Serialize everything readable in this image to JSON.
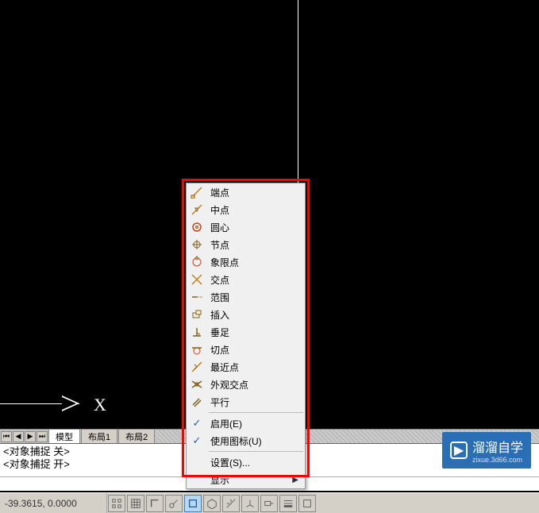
{
  "canvas": {
    "coord_display": "-39.3615, 0.0000"
  },
  "tabs": {
    "items": [
      "模型",
      "布局1",
      "布局2"
    ],
    "active_index": 0
  },
  "command_log": {
    "lines": [
      "<对象捕捉 关>",
      "<对象捕捉 开>"
    ]
  },
  "osnap_menu": {
    "items": [
      {
        "label": "端点",
        "icon": "endpoint"
      },
      {
        "label": "中点",
        "icon": "midpoint"
      },
      {
        "label": "圆心",
        "icon": "center"
      },
      {
        "label": "节点",
        "icon": "node"
      },
      {
        "label": "象限点",
        "icon": "quadrant"
      },
      {
        "label": "交点",
        "icon": "intersection"
      },
      {
        "label": "范围",
        "icon": "extension"
      },
      {
        "label": "插入",
        "icon": "insert"
      },
      {
        "label": "垂足",
        "icon": "perpendicular"
      },
      {
        "label": "切点",
        "icon": "tangent"
      },
      {
        "label": "最近点",
        "icon": "nearest"
      },
      {
        "label": "外观交点",
        "icon": "apparent-intersection"
      },
      {
        "label": "平行",
        "icon": "parallel"
      }
    ],
    "toggles": [
      {
        "label": "启用(E)",
        "checked": true
      },
      {
        "label": "使用图标(U)",
        "checked": true
      }
    ],
    "footer": [
      {
        "label": "设置(S)...",
        "submenu": false
      },
      {
        "label": "显示",
        "submenu": true
      }
    ]
  },
  "watermark": {
    "title": "溜溜自学",
    "url": "zixue.3d66.com"
  },
  "x_label": "X"
}
